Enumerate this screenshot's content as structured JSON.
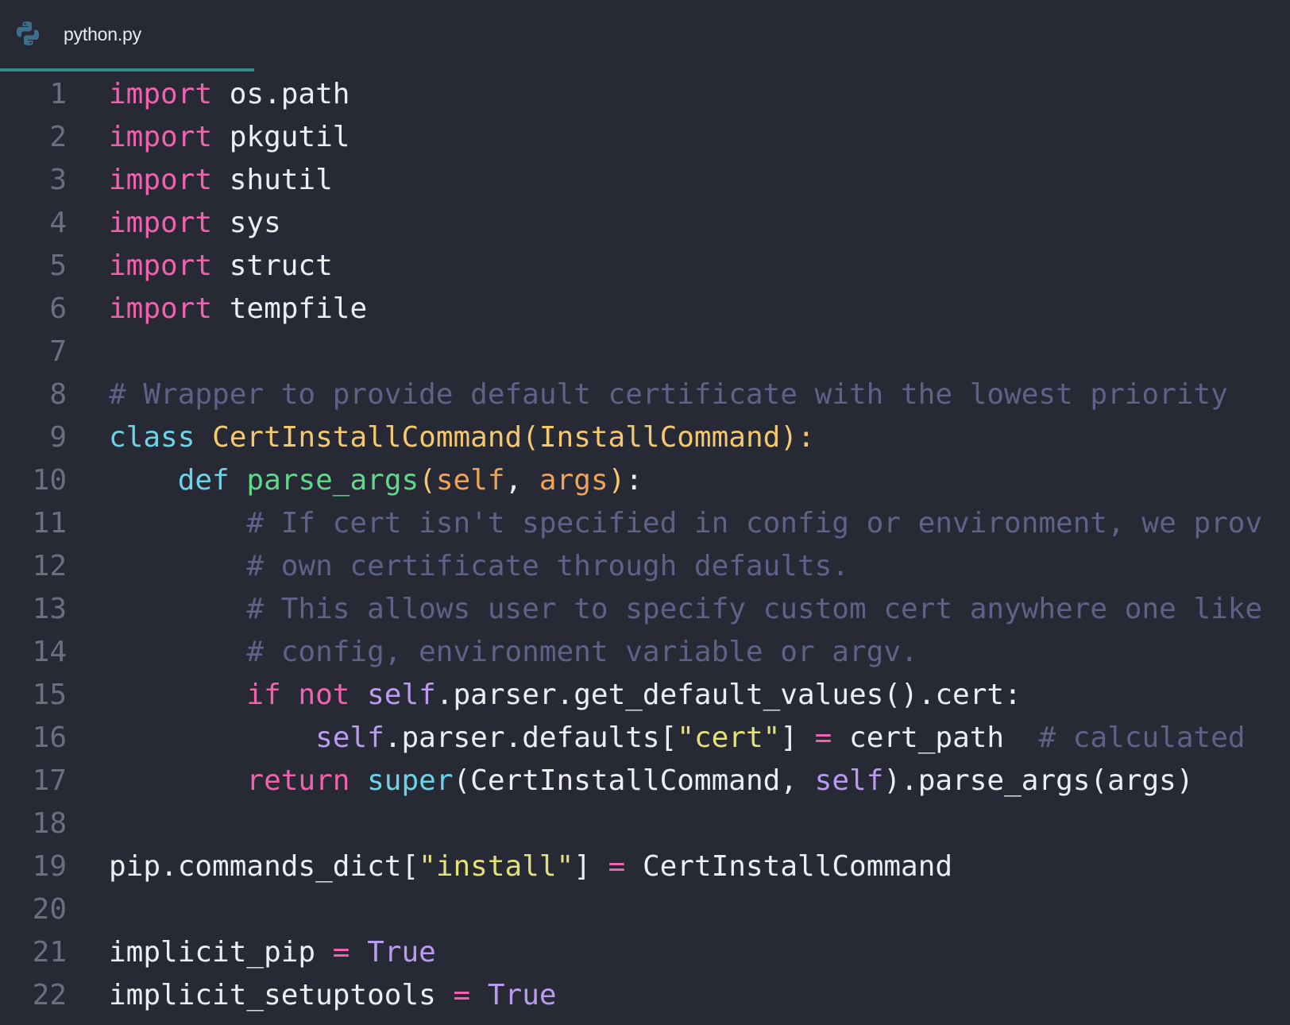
{
  "tab": {
    "filename": "python.py",
    "icon": "python-icon"
  },
  "colors": {
    "background": "#272935",
    "tab_accent": "#2f8f8a",
    "keyword": "#f062ad",
    "storage": "#6dd3e6",
    "class_name": "#f3c86e",
    "function": "#5fd88a",
    "parameter": "#f0a257",
    "self": "#b99cf0",
    "string": "#e4e07a",
    "comment": "#5d6286",
    "text": "#eceef4",
    "line_number": "#6b6f80"
  },
  "lines": [
    {
      "n": "1",
      "tokens": [
        {
          "t": "keyword",
          "v": "import"
        },
        {
          "t": "plain",
          "v": " os.path"
        }
      ]
    },
    {
      "n": "2",
      "tokens": [
        {
          "t": "keyword",
          "v": "import"
        },
        {
          "t": "plain",
          "v": " pkgutil"
        }
      ]
    },
    {
      "n": "3",
      "tokens": [
        {
          "t": "keyword",
          "v": "import"
        },
        {
          "t": "plain",
          "v": " shutil"
        }
      ]
    },
    {
      "n": "4",
      "tokens": [
        {
          "t": "keyword",
          "v": "import"
        },
        {
          "t": "plain",
          "v": " sys"
        }
      ]
    },
    {
      "n": "5",
      "tokens": [
        {
          "t": "keyword",
          "v": "import"
        },
        {
          "t": "plain",
          "v": " struct"
        }
      ]
    },
    {
      "n": "6",
      "tokens": [
        {
          "t": "keyword",
          "v": "import"
        },
        {
          "t": "plain",
          "v": " tempfile"
        }
      ]
    },
    {
      "n": "7",
      "tokens": []
    },
    {
      "n": "8",
      "tokens": [
        {
          "t": "comment",
          "v": "# Wrapper to provide default certificate with the lowest priority"
        }
      ]
    },
    {
      "n": "9",
      "tokens": [
        {
          "t": "storage",
          "v": "class"
        },
        {
          "t": "plain",
          "v": " "
        },
        {
          "t": "class",
          "v": "CertInstallCommand(InstallCommand):"
        }
      ]
    },
    {
      "n": "10",
      "tokens": [
        {
          "t": "plain",
          "v": "    "
        },
        {
          "t": "storage",
          "v": "def"
        },
        {
          "t": "plain",
          "v": " "
        },
        {
          "t": "func",
          "v": "parse_args"
        },
        {
          "t": "class",
          "v": "("
        },
        {
          "t": "param",
          "v": "self"
        },
        {
          "t": "plain",
          "v": ", "
        },
        {
          "t": "param",
          "v": "args"
        },
        {
          "t": "class",
          "v": ")"
        },
        {
          "t": "plain",
          "v": ":"
        }
      ]
    },
    {
      "n": "11",
      "tokens": [
        {
          "t": "plain",
          "v": "        "
        },
        {
          "t": "comment",
          "v": "# If cert isn't specified in config or environment, we prov"
        }
      ]
    },
    {
      "n": "12",
      "tokens": [
        {
          "t": "plain",
          "v": "        "
        },
        {
          "t": "comment",
          "v": "# own certificate through defaults."
        }
      ]
    },
    {
      "n": "13",
      "tokens": [
        {
          "t": "plain",
          "v": "        "
        },
        {
          "t": "comment",
          "v": "# This allows user to specify custom cert anywhere one like"
        }
      ]
    },
    {
      "n": "14",
      "tokens": [
        {
          "t": "plain",
          "v": "        "
        },
        {
          "t": "comment",
          "v": "# config, environment variable or argv."
        }
      ]
    },
    {
      "n": "15",
      "tokens": [
        {
          "t": "plain",
          "v": "        "
        },
        {
          "t": "keyword",
          "v": "if not"
        },
        {
          "t": "plain",
          "v": " "
        },
        {
          "t": "self",
          "v": "self"
        },
        {
          "t": "plain",
          "v": ".parser.get_default_values().cert:"
        }
      ]
    },
    {
      "n": "16",
      "tokens": [
        {
          "t": "plain",
          "v": "            "
        },
        {
          "t": "self",
          "v": "self"
        },
        {
          "t": "plain",
          "v": ".parser.defaults["
        },
        {
          "t": "string",
          "v": "\"cert\""
        },
        {
          "t": "plain",
          "v": "] "
        },
        {
          "t": "op",
          "v": "="
        },
        {
          "t": "plain",
          "v": " cert_path  "
        },
        {
          "t": "comment",
          "v": "# calculated"
        }
      ]
    },
    {
      "n": "17",
      "tokens": [
        {
          "t": "plain",
          "v": "        "
        },
        {
          "t": "keyword",
          "v": "return"
        },
        {
          "t": "plain",
          "v": " "
        },
        {
          "t": "builtin",
          "v": "super"
        },
        {
          "t": "plain",
          "v": "(CertInstallCommand, "
        },
        {
          "t": "self",
          "v": "self"
        },
        {
          "t": "plain",
          "v": ").parse_args(args)"
        }
      ]
    },
    {
      "n": "18",
      "tokens": []
    },
    {
      "n": "19",
      "tokens": [
        {
          "t": "plain",
          "v": "pip.commands_dict["
        },
        {
          "t": "string",
          "v": "\"install\""
        },
        {
          "t": "plain",
          "v": "] "
        },
        {
          "t": "op",
          "v": "="
        },
        {
          "t": "plain",
          "v": " CertInstallCommand"
        }
      ]
    },
    {
      "n": "20",
      "tokens": []
    },
    {
      "n": "21",
      "tokens": [
        {
          "t": "plain",
          "v": "implicit_pip "
        },
        {
          "t": "op",
          "v": "="
        },
        {
          "t": "plain",
          "v": " "
        },
        {
          "t": "const",
          "v": "True"
        }
      ]
    },
    {
      "n": "22",
      "tokens": [
        {
          "t": "plain",
          "v": "implicit_setuptools "
        },
        {
          "t": "op",
          "v": "="
        },
        {
          "t": "plain",
          "v": " "
        },
        {
          "t": "const",
          "v": "True"
        }
      ]
    }
  ]
}
